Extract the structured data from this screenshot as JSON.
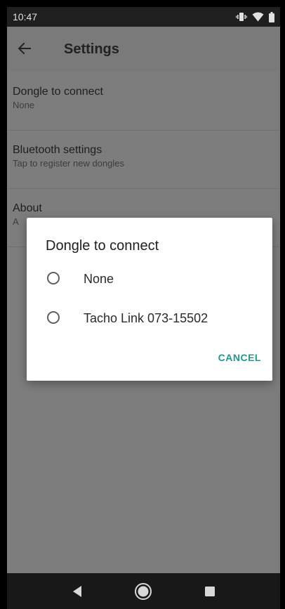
{
  "status_bar": {
    "time": "10:47",
    "icons": [
      "vibrate-icon",
      "wifi-icon",
      "battery-icon"
    ]
  },
  "app_bar": {
    "back_icon": "arrow-left-icon",
    "title": "Settings"
  },
  "settings": {
    "items": [
      {
        "title": "Dongle to connect",
        "summary": "None"
      },
      {
        "title": "Bluetooth settings",
        "summary": "Tap to register new dongles"
      },
      {
        "title": "About",
        "summary": "A"
      }
    ]
  },
  "dialog": {
    "title": "Dongle to connect",
    "options": [
      {
        "label": "None",
        "selected": false
      },
      {
        "label": "Tacho Link 073-15502",
        "selected": false
      }
    ],
    "cancel_label": "CANCEL"
  },
  "nav_bar": {
    "buttons": [
      "back-triangle-icon",
      "home-circle-icon",
      "recents-square-icon"
    ]
  },
  "colors": {
    "accent": "#1e9a8f",
    "scrim_background": "#7d7d7d",
    "status_bar": "#1f1f1f",
    "nav_bar": "#181818"
  }
}
